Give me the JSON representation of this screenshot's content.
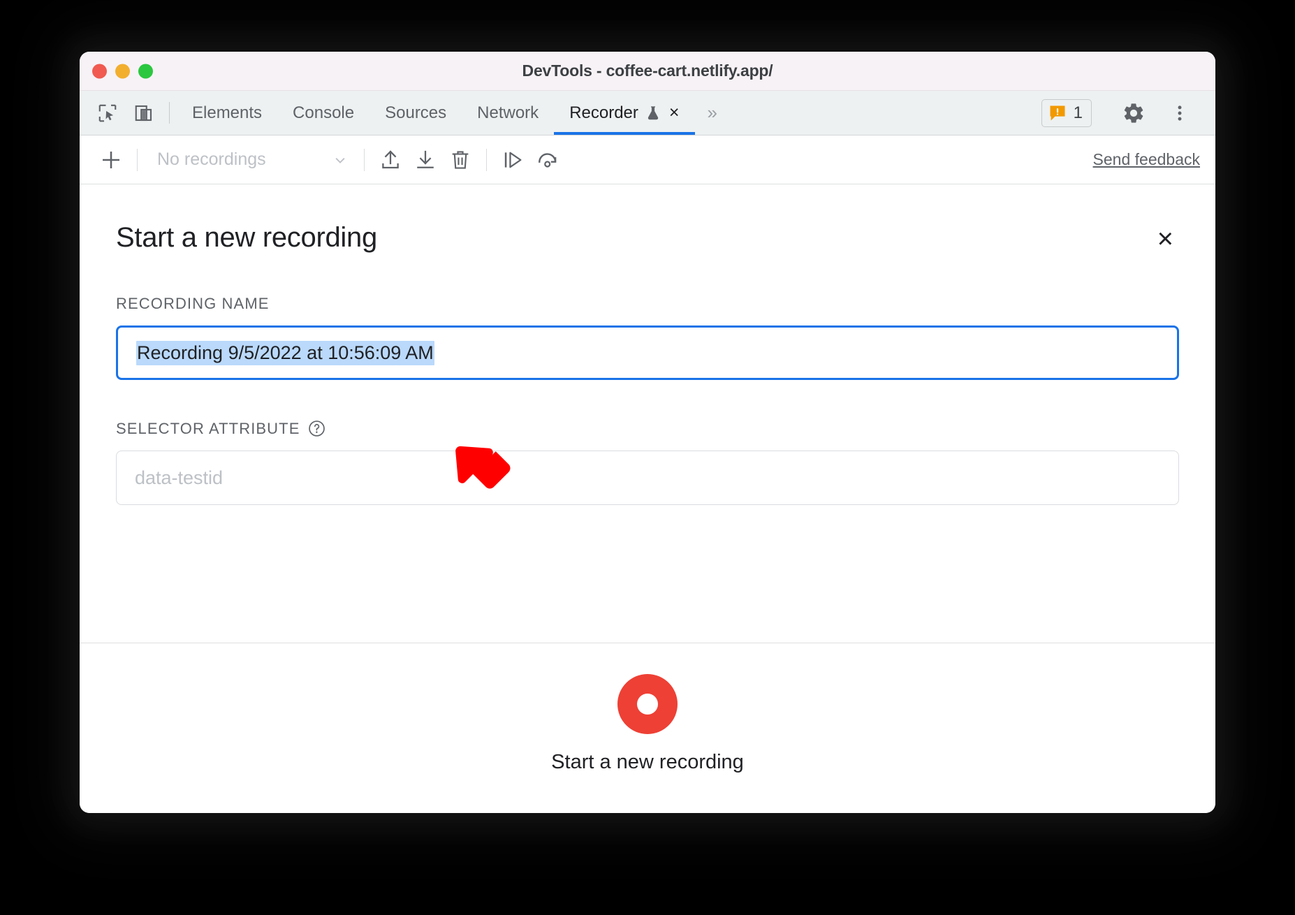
{
  "window": {
    "title": "DevTools - coffee-cart.netlify.app/",
    "traffic_lights": [
      "close-red",
      "minimize-yellow",
      "zoom-green"
    ]
  },
  "devtools": {
    "left_icons": [
      "inspect-element-icon",
      "device-toolbar-icon"
    ],
    "tabs": [
      {
        "label": "Elements",
        "active": false
      },
      {
        "label": "Console",
        "active": false
      },
      {
        "label": "Sources",
        "active": false
      },
      {
        "label": "Network",
        "active": false
      },
      {
        "label": "Recorder",
        "active": true,
        "experimental_icon": "flask-icon",
        "close_glyph": "×"
      }
    ],
    "overflow_glyph": "»",
    "warning_badge": {
      "icon": "warning-icon",
      "count": "1",
      "color": "#f29900"
    },
    "settings_icon": "gear-icon",
    "more_icon": "kebab-menu-icon"
  },
  "recorder_toolbar": {
    "add_label": "+",
    "recordings_select_value": "No recordings",
    "dropdown_glyph": "∨",
    "buttons": [
      {
        "name": "import-recording",
        "icon": "upload-icon"
      },
      {
        "name": "export-recording",
        "icon": "download-icon"
      },
      {
        "name": "delete-recording",
        "icon": "trash-icon"
      },
      {
        "name": "step-over",
        "icon": "step-play-icon"
      },
      {
        "name": "replay",
        "icon": "replay-icon"
      }
    ],
    "send_feedback": "Send feedback"
  },
  "panel": {
    "title": "Start a new recording",
    "close_glyph": "×",
    "recording_name": {
      "label": "RECORDING NAME",
      "value": "Recording 9/5/2022 at 10:56:09 AM",
      "focused": true,
      "selection_color": "#bad9fb",
      "border_color": "#1a73e8"
    },
    "selector_attribute": {
      "label": "SELECTOR ATTRIBUTE",
      "help_icon": "help-circle-icon",
      "placeholder": "data-testid",
      "value": ""
    },
    "footer": {
      "record_button_label": "Start a new recording",
      "record_button_color": "#ee4035",
      "record_icon": "record-dot-icon"
    }
  },
  "annotation": {
    "arrow": {
      "name": "red-pointer-arrow",
      "color": "#ff0000",
      "direction": "down-left"
    }
  }
}
